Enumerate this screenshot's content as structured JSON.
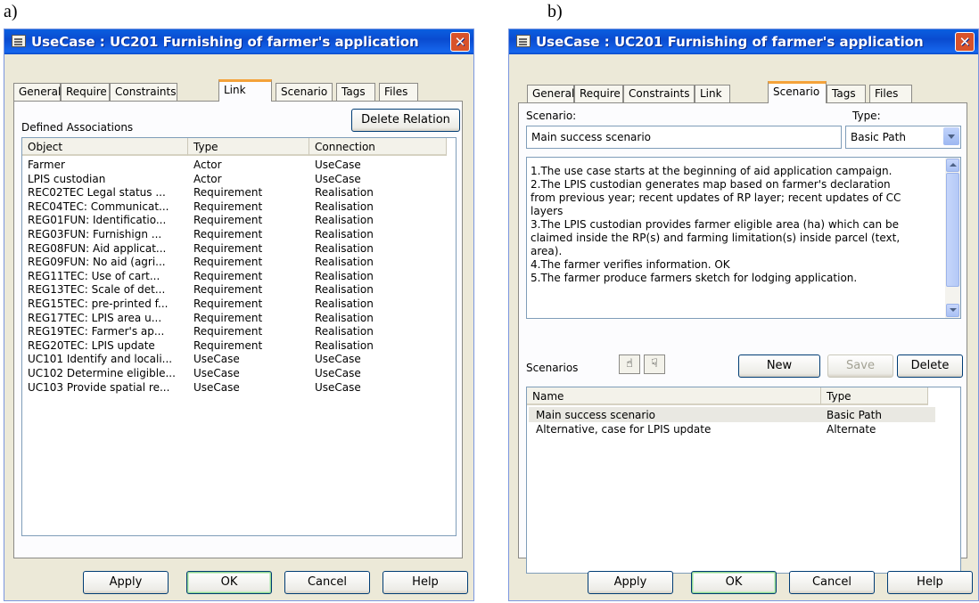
{
  "labels": {
    "a": "a)",
    "b": "b)"
  },
  "window_a": {
    "title": "UseCase : UC201  Furnishing of farmer's application",
    "close_icon": "close-icon",
    "tabs": [
      "General",
      "Require",
      "Constraints",
      "Link",
      "Scenario",
      "Tags",
      "Files"
    ],
    "active_tab": "Link",
    "defined_associations_label": "Defined Associations",
    "delete_relation_label": "Delete Relation",
    "columns": [
      "Object",
      "Type",
      "Connection"
    ],
    "rows": [
      [
        "Farmer",
        "Actor",
        "UseCase"
      ],
      [
        "LPIS custodian",
        "Actor",
        "UseCase"
      ],
      [
        "REC02TEC Legal status ...",
        "Requirement",
        "Realisation"
      ],
      [
        "REC04TEC: Communicat...",
        "Requirement",
        "Realisation"
      ],
      [
        "REG01FUN: Identificatio...",
        "Requirement",
        "Realisation"
      ],
      [
        "REG03FUN: Furnishign ...",
        "Requirement",
        "Realisation"
      ],
      [
        "REG08FUN: Aid applicat...",
        "Requirement",
        "Realisation"
      ],
      [
        "REG09FUN: No aid (agri...",
        "Requirement",
        "Realisation"
      ],
      [
        "REG11TEC: Use of  cart...",
        "Requirement",
        "Realisation"
      ],
      [
        "REG13TEC: Scale of det...",
        "Requirement",
        "Realisation"
      ],
      [
        "REG15TEC: pre-printed f...",
        "Requirement",
        "Realisation"
      ],
      [
        "REG17TEC: LPIS area u...",
        "Requirement",
        "Realisation"
      ],
      [
        "REG19TEC: Farmer's ap...",
        "Requirement",
        "Realisation"
      ],
      [
        "REG20TEC: LPIS update",
        "Requirement",
        "Realisation"
      ],
      [
        "UC101 Identify and locali...",
        "UseCase",
        "UseCase"
      ],
      [
        "UC102 Determine eligible...",
        "UseCase",
        "UseCase"
      ],
      [
        "UC103 Provide spatial re...",
        "UseCase",
        "UseCase"
      ]
    ],
    "buttons": {
      "apply": "Apply",
      "ok": "OK",
      "cancel": "Cancel",
      "help": "Help"
    }
  },
  "window_b": {
    "title": "UseCase : UC201  Furnishing of farmer's application",
    "close_icon": "close-icon",
    "tabs": [
      "General",
      "Require",
      "Constraints",
      "Link",
      "Scenario",
      "Tags",
      "Files"
    ],
    "active_tab": "Scenario",
    "scenario_label": "Scenario:",
    "scenario_value": "Main success scenario",
    "type_label": "Type:",
    "type_value": "Basic Path",
    "description_lines": [
      "1.The use case starts at the beginning of aid application campaign.",
      "2.The LPIS custodian generates map based on farmer's declaration",
      "from previous year; recent updates of RP layer; recent updates of CC",
      "layers",
      "3.The LPIS custodian provides farmer eligible area (ha) which can be",
      "claimed inside the RP(s) and farming limitation(s) inside parcel (text,",
      "area).",
      "4.The farmer verifies information. OK",
      "5.The farmer produce farmers sketch for lodging application."
    ],
    "scenarios_label": "Scenarios",
    "scenario_buttons": {
      "new": "New",
      "save": "Save",
      "delete": "Delete"
    },
    "move_up_icon": "move-up-icon",
    "move_down_icon": "move-down-icon",
    "columns": [
      "Name",
      "Type"
    ],
    "rows": [
      [
        "Main success scenario",
        "Basic Path"
      ],
      [
        "Alternative, case for LPIS update",
        "Alternate"
      ]
    ],
    "buttons": {
      "apply": "Apply",
      "ok": "OK",
      "cancel": "Cancel",
      "help": "Help"
    }
  }
}
